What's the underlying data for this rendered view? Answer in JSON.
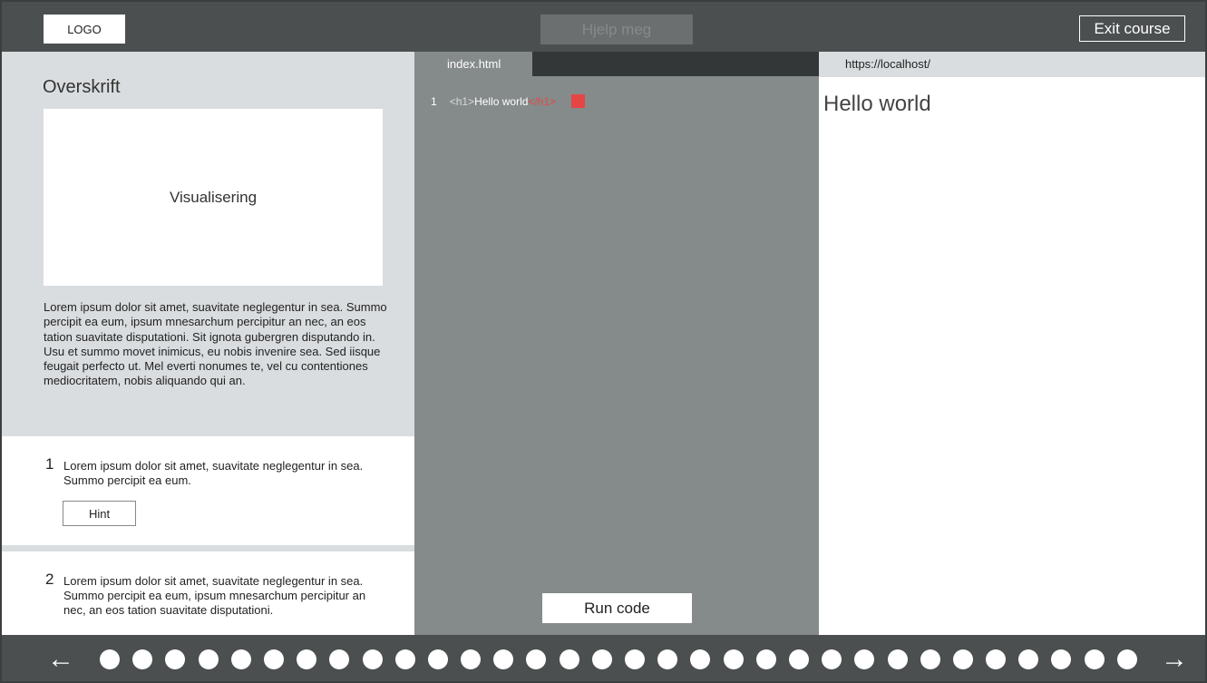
{
  "header": {
    "logo_label": "LOGO",
    "help_label": "Hjelp meg",
    "exit_label": "Exit course"
  },
  "lesson": {
    "title": "Overskrift",
    "visual_label": "Visualisering",
    "body": "Lorem ipsum dolor sit amet, suavitate neglegentur in sea. Summo percipit ea eum, ipsum mnesarchum percipitur an nec, an eos tation suavitate disputationi. Sit ignota gubergren disputando in. Usu et summo movet inimicus, eu nobis invenire sea. Sed iisque feugait perfecto ut. Mel everti nonumes te, vel cu contentiones mediocritatem, nobis aliquando qui an."
  },
  "tasks": [
    {
      "number": "1",
      "text": "Lorem ipsum dolor sit amet, suavitate neglegentur in sea. Summo percipit ea eum.",
      "hint_label": "Hint"
    },
    {
      "number": "2",
      "text": "Lorem ipsum dolor sit amet, suavitate neglegentur in sea. Summo percipit ea eum, ipsum mnesarchum percipitur an nec, an eos tation suavitate disputationi."
    }
  ],
  "editor": {
    "tab_label": "index.html",
    "line_number": "1",
    "code_open_tag": "<h1>",
    "code_text": "Hello world",
    "code_close_tag": "</h1>",
    "run_label": "Run code",
    "error_color": "#e64545"
  },
  "preview": {
    "url": "https://localhost/",
    "heading": "Hello world"
  },
  "footer": {
    "prev_icon": "arrow-left-icon",
    "next_icon": "arrow-right-icon",
    "prev_glyph": "←",
    "next_glyph": "→",
    "progress_step_count": 32
  }
}
